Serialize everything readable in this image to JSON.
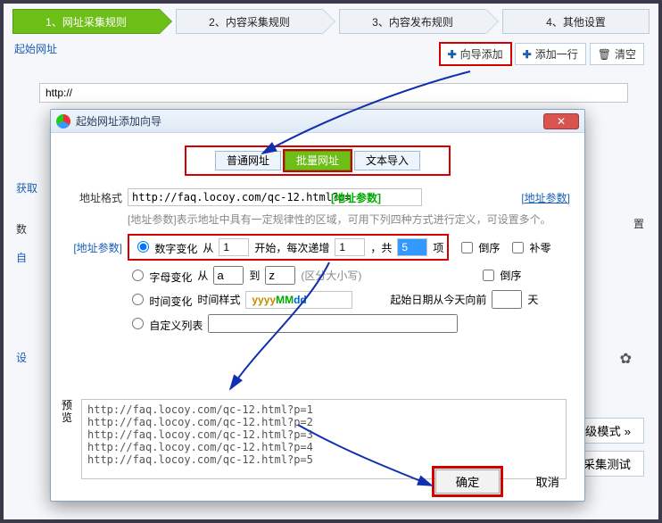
{
  "steps": {
    "s1": "1、网址采集规则",
    "s2": "2、内容采集规则",
    "s3": "3、内容发布规则",
    "s4": "4、其他设置"
  },
  "section": {
    "start_url": "起始网址"
  },
  "toolbar": {
    "wizard_add": "向导添加",
    "add_row": "添加一行",
    "clear": "清空"
  },
  "url_field": {
    "value": "http://"
  },
  "left": {
    "get": "获取",
    "nums": "数",
    "self": "自",
    "set": "设",
    "gear": "⚙",
    "settings_right": "置"
  },
  "bottom": {
    "adv": "高级模式 »",
    "test": "网址采集测试"
  },
  "dialog": {
    "title": "起始网址添加向导",
    "tabs": {
      "normal": "普通网址",
      "batch": "批量网址",
      "import": "文本导入"
    },
    "format_label": "地址格式",
    "format_value": "http://faq.locoy.com/qc-12.html?p=",
    "format_token": "[地址参数]",
    "format_link": "[地址参数]",
    "hint": "[地址参数]表示地址中具有一定规律性的区域，可用下列四种方式进行定义，可设置多个。",
    "param_label": "[地址参数]",
    "radios": {
      "num": "数字变化",
      "alpha": "字母变化",
      "time": "时间变化",
      "custom": "自定义列表"
    },
    "num": {
      "from_lbl": "从",
      "from": "1",
      "start_lbl": "开始，每次递增",
      "step": "1",
      "count_lbl": "，共",
      "count": "5",
      "unit": "项",
      "reverse": "倒序",
      "pad": "补零"
    },
    "alpha": {
      "from_lbl": "从",
      "from": "a",
      "to_lbl": "到",
      "to": "z",
      "case": "(区分大小写)",
      "reverse": "倒序"
    },
    "time": {
      "style_lbl": "时间样式",
      "y": "yyyy",
      "m": "MM",
      "d": "dd",
      "days_lbl": "起始日期从今天向前",
      "days_unit": "天"
    },
    "preview_label": "预览",
    "preview": "http://faq.locoy.com/qc-12.html?p=1\nhttp://faq.locoy.com/qc-12.html?p=2\nhttp://faq.locoy.com/qc-12.html?p=3\nhttp://faq.locoy.com/qc-12.html?p=4\nhttp://faq.locoy.com/qc-12.html?p=5",
    "ok": "确定",
    "cancel": "取消"
  }
}
